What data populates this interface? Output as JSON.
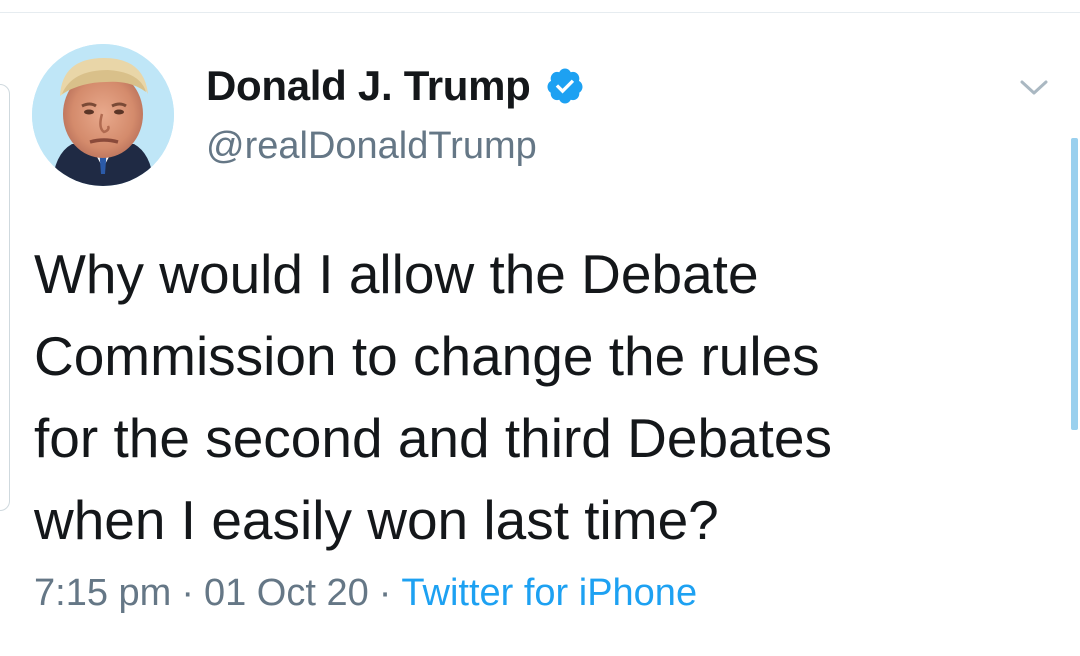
{
  "tweet": {
    "author": {
      "display_name": "Donald J. Trump",
      "handle": "@realDonaldTrump",
      "verified": true,
      "avatar_icon": "profile-photo"
    },
    "text_lines": [
      "Why would I allow the Debate",
      "Commission to change the rules",
      "for the second and third Debates",
      "when I easily won last time?"
    ],
    "meta": {
      "time": "7:15 pm",
      "separator": "·",
      "date": "01 Oct 20",
      "source": "Twitter for iPhone"
    },
    "menu_icon": "chevron-down-icon"
  },
  "colors": {
    "text_primary": "#14171a",
    "text_secondary": "#657786",
    "accent": "#1da1f2",
    "scroll_indicator": "#9ad0ee"
  }
}
